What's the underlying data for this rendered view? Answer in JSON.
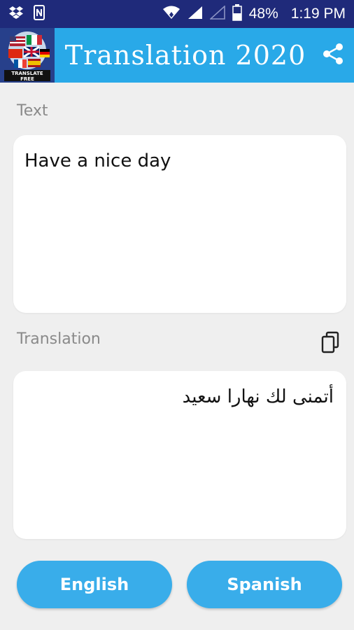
{
  "status_bar": {
    "battery": "48%",
    "time": "1:19 PM",
    "icons": [
      "dropbox-icon",
      "sim-icon",
      "wifi-icon",
      "signal-icon",
      "signal-empty-icon",
      "battery-icon"
    ]
  },
  "app_bar": {
    "logo_text": "TRANSLATE FREE",
    "title": "Translation 2020",
    "share_icon": "share-icon"
  },
  "input_section": {
    "label": "Text",
    "value": "Have a nice day"
  },
  "output_section": {
    "label": "Translation",
    "value": "أتمنى لك نهارا سعيد",
    "copy_icon": "copy-icon"
  },
  "languages": {
    "source": "English",
    "target": "Spanish"
  },
  "colors": {
    "status_bar": "#1f2a7a",
    "app_bar": "#29a9e8",
    "button": "#39adea",
    "background": "#efefef"
  }
}
